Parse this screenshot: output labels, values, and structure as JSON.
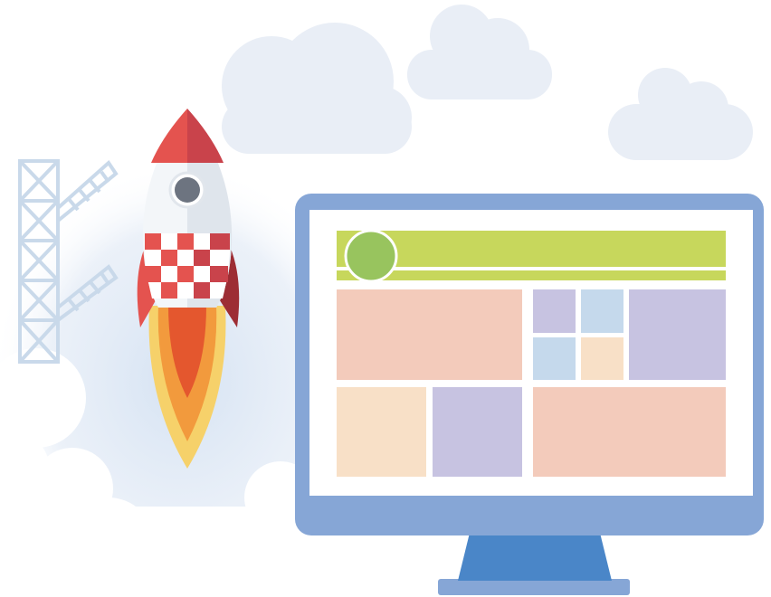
{
  "illustration": {
    "subject": "",
    "colors": {
      "sky_cloud": "#e9eef6",
      "smoke": "#dfe8f4",
      "tower": "#c9d9ea",
      "rocket_body": "#f3f6f9",
      "rocket_red": "#e4534f",
      "rocket_dark_red": "#9d2d34",
      "flame_outer": "#f6d16a",
      "flame_mid": "#f29a3d",
      "flame_inner": "#e4572e",
      "monitor_frame": "#86a6d6",
      "monitor_stand": "#4a86c8",
      "screen": "#ffffff",
      "header_bar": "#c7d75c",
      "avatar": "#98c45e",
      "tile_salmon": "#f3cbbb",
      "tile_lavender": "#c7c3e1",
      "tile_blue": "#c5d9ec",
      "tile_peach": "#f8e0c7"
    },
    "icons": [
      "rocket-icon",
      "launch-tower-icon",
      "monitor-icon",
      "cloud-icon"
    ]
  }
}
